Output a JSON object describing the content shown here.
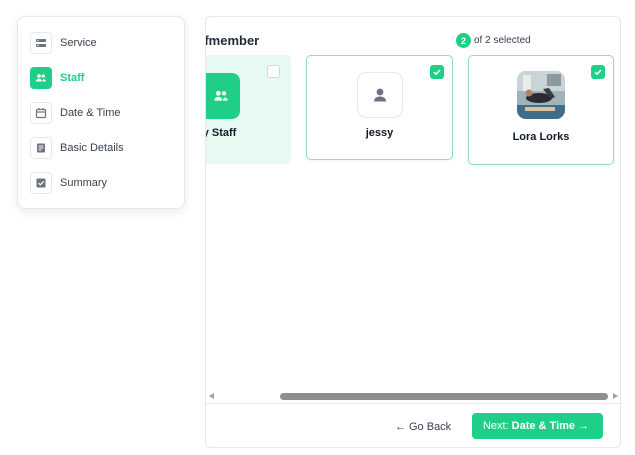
{
  "sidebar": {
    "steps": [
      {
        "label": "Service",
        "icon": "service-icon",
        "active": false
      },
      {
        "label": "Staff",
        "icon": "staff-group-icon",
        "active": true
      },
      {
        "label": "Date & Time",
        "icon": "calendar-icon",
        "active": false
      },
      {
        "label": "Basic Details",
        "icon": "document-icon",
        "active": false
      },
      {
        "label": "Summary",
        "icon": "checkbox-icon",
        "active": false
      }
    ]
  },
  "main": {
    "title": "ffmember",
    "selection": {
      "count": "2",
      "text": "of 2 selected"
    },
    "cards": [
      {
        "name": "ny Staff",
        "selected": false,
        "icon": "staff-group-icon"
      },
      {
        "name": "jessy",
        "selected": true,
        "icon": "user-icon"
      },
      {
        "name": "Lora Lorks",
        "selected": true,
        "icon": "profile-photo"
      }
    ]
  },
  "footer": {
    "back_arrow": "←",
    "back_label": "Go Back",
    "next_prefix": "Next:",
    "next_label": "Date & Time",
    "next_arrow": "→"
  },
  "colors": {
    "accent": "#1fcf87",
    "accent_light": "#e6faf1",
    "border": "#e5e7eb"
  }
}
